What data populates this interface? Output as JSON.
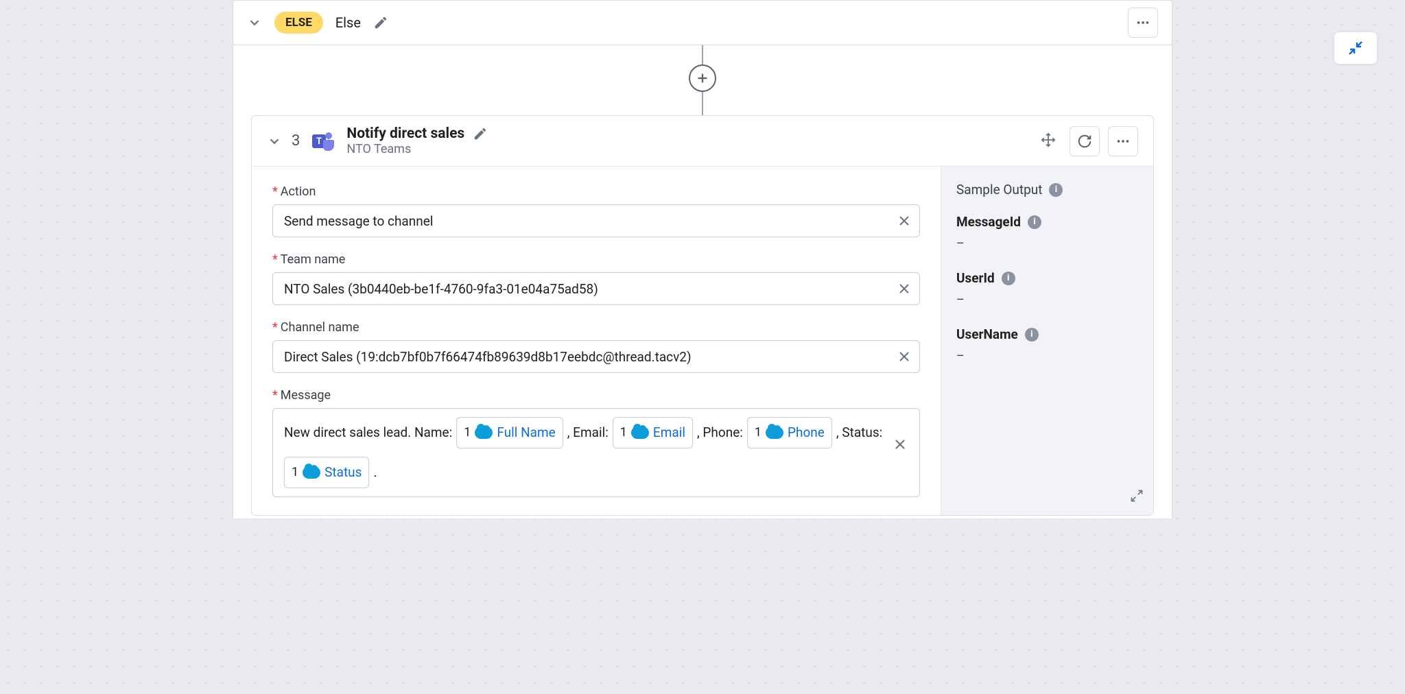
{
  "else_row": {
    "badge": "ELSE",
    "label": "Else"
  },
  "step": {
    "number": "3",
    "title": "Notify direct sales",
    "subtitle": "NTO Teams"
  },
  "fields": {
    "action": {
      "label": "Action",
      "value": "Send message to channel"
    },
    "team": {
      "label": "Team name",
      "value": "NTO Sales (3b0440eb-be1f-4760-9fa3-01e04a75ad58)"
    },
    "channel": {
      "label": "Channel name",
      "value": "Direct Sales (19:dcb7bf0b7f66474fb89639d8b17eebdc@thread.tacv2)"
    },
    "message": {
      "label": "Message"
    }
  },
  "msg": {
    "t1": "New direct sales lead. Name:",
    "p1": {
      "num": "1",
      "label": "Full Name"
    },
    "t2": ", Email:",
    "p2": {
      "num": "1",
      "label": "Email"
    },
    "t3": ", Phone:",
    "p3": {
      "num": "1",
      "label": "Phone"
    },
    "t4": ", Status:",
    "p4": {
      "num": "1",
      "label": "Status"
    },
    "t5": "."
  },
  "output": {
    "title": "Sample Output",
    "items": [
      {
        "label": "MessageId",
        "value": "–"
      },
      {
        "label": "UserId",
        "value": "–"
      },
      {
        "label": "UserName",
        "value": "–"
      }
    ]
  }
}
